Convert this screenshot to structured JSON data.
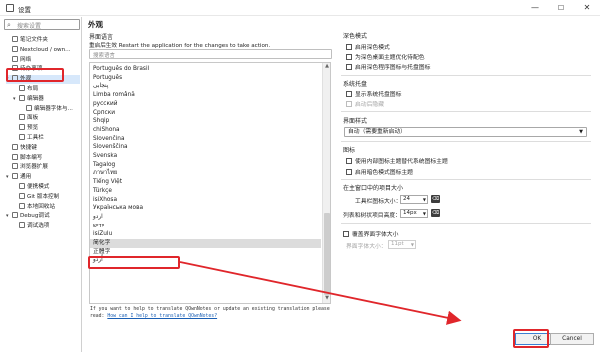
{
  "window": {
    "title": "设置",
    "minimize": "—",
    "maximize": "☐",
    "close": "✕"
  },
  "sidebar": {
    "search_placeholder": "搜索设置",
    "items": [
      {
        "label": "笔记文件夹",
        "indent": 0,
        "arrow": ""
      },
      {
        "label": "Nextcloud / own...",
        "indent": 0,
        "arrow": ""
      },
      {
        "label": "网络",
        "indent": 0,
        "arrow": ""
      },
      {
        "label": "待办事项",
        "indent": 0,
        "arrow": ""
      },
      {
        "label": "外观",
        "indent": 0,
        "arrow": "▾"
      },
      {
        "label": "布局",
        "indent": 1,
        "arrow": ""
      },
      {
        "label": "编辑器",
        "indent": 1,
        "arrow": "▾"
      },
      {
        "label": "编辑器字体与...",
        "indent": 2,
        "arrow": ""
      },
      {
        "label": "面板",
        "indent": 1,
        "arrow": ""
      },
      {
        "label": "预览",
        "indent": 1,
        "arrow": ""
      },
      {
        "label": "工具栏",
        "indent": 1,
        "arrow": ""
      },
      {
        "label": "快捷键",
        "indent": 0,
        "arrow": ""
      },
      {
        "label": "脚本编写",
        "indent": 0,
        "arrow": ""
      },
      {
        "label": "浏览器扩展",
        "indent": 0,
        "arrow": ""
      },
      {
        "label": "通用",
        "indent": 0,
        "arrow": "▾"
      },
      {
        "label": "便携模式",
        "indent": 1,
        "arrow": ""
      },
      {
        "label": "Git 版本控制",
        "indent": 1,
        "arrow": ""
      },
      {
        "label": "本地回收站",
        "indent": 1,
        "arrow": ""
      },
      {
        "label": "Debug调试",
        "indent": 0,
        "arrow": "▾"
      },
      {
        "label": "调试选项",
        "indent": 1,
        "arrow": ""
      }
    ]
  },
  "main": {
    "title": "外观",
    "language_section": "界面语言",
    "restart_note": "重启后生效 Restart the application for the changes to take action.",
    "search_placeholder": "搜索语言",
    "languages": [
      "Português do Brasil",
      "Português",
      "پنجابی",
      "Limba română",
      "русский",
      "Српски",
      "Shqip",
      "chiShona",
      "Slovenčina",
      "Slovenščina",
      "Svenska",
      "Tagalog",
      "ภาษาไทย",
      "Tiếng Việt",
      "Türkçe",
      "isiXhosa",
      "Українська мова",
      "اردو",
      "ייִדיש",
      "isiZulu",
      "简化字",
      "正體字",
      "اُردو"
    ],
    "selected_language_index": 20,
    "footer_text": "If you want to help to translate QOwnNotes or update an existing translation please read:",
    "footer_link": "How can I help to translate QOwnNotes?"
  },
  "right": {
    "dark_mode": {
      "title": "深色模式",
      "options": [
        {
          "label": "启用深色模式",
          "checked": false,
          "disabled": false
        },
        {
          "label": "为深色桌面主题优化待配色",
          "checked": false,
          "disabled": false
        },
        {
          "label": "启用深色程序图标与托盘图标",
          "checked": false,
          "disabled": false
        }
      ]
    },
    "tray": {
      "title": "系统托盘",
      "options": [
        {
          "label": "显示系统托盘图标",
          "checked": false,
          "disabled": false
        },
        {
          "label": "启动后隐藏",
          "checked": false,
          "disabled": true
        }
      ]
    },
    "ui_style": {
      "title": "界面样式",
      "value": "自动（需要重新启动）"
    },
    "icons": {
      "title": "图标",
      "options": [
        {
          "label": "使用内部图标主题替代系统图标主题",
          "checked": false,
          "disabled": false
        },
        {
          "label": "启用暗色模式图标主题",
          "checked": false,
          "disabled": false
        }
      ]
    },
    "icon_size": {
      "title": "在主窗口中的项目大小",
      "toolbar_label": "工具栏图标大小：",
      "toolbar_value": "24",
      "list_label": "列表和树状项目高度：",
      "list_value": "14px"
    },
    "ui_font": {
      "checkbox": "覆盖界面字体大小",
      "size_label": "界面字体大小：",
      "size_value": "11pt"
    }
  },
  "dialog": {
    "ok": "OK",
    "cancel": "Cancel"
  },
  "annotation_color": "#e0262b"
}
